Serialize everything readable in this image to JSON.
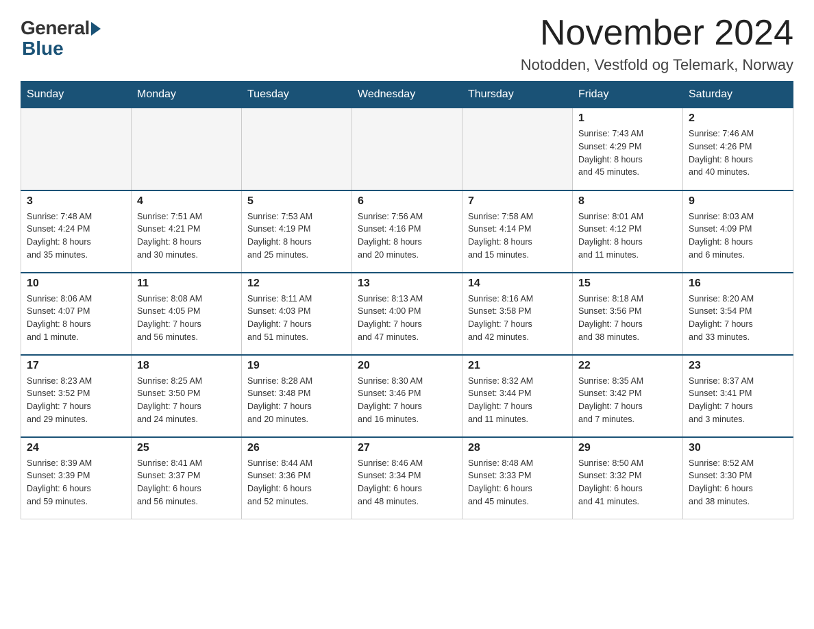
{
  "logo": {
    "general": "General",
    "blue": "Blue"
  },
  "title": "November 2024",
  "location": "Notodden, Vestfold og Telemark, Norway",
  "days_of_week": [
    "Sunday",
    "Monday",
    "Tuesday",
    "Wednesday",
    "Thursday",
    "Friday",
    "Saturday"
  ],
  "weeks": [
    [
      {
        "day": "",
        "info": ""
      },
      {
        "day": "",
        "info": ""
      },
      {
        "day": "",
        "info": ""
      },
      {
        "day": "",
        "info": ""
      },
      {
        "day": "",
        "info": ""
      },
      {
        "day": "1",
        "info": "Sunrise: 7:43 AM\nSunset: 4:29 PM\nDaylight: 8 hours\nand 45 minutes."
      },
      {
        "day": "2",
        "info": "Sunrise: 7:46 AM\nSunset: 4:26 PM\nDaylight: 8 hours\nand 40 minutes."
      }
    ],
    [
      {
        "day": "3",
        "info": "Sunrise: 7:48 AM\nSunset: 4:24 PM\nDaylight: 8 hours\nand 35 minutes."
      },
      {
        "day": "4",
        "info": "Sunrise: 7:51 AM\nSunset: 4:21 PM\nDaylight: 8 hours\nand 30 minutes."
      },
      {
        "day": "5",
        "info": "Sunrise: 7:53 AM\nSunset: 4:19 PM\nDaylight: 8 hours\nand 25 minutes."
      },
      {
        "day": "6",
        "info": "Sunrise: 7:56 AM\nSunset: 4:16 PM\nDaylight: 8 hours\nand 20 minutes."
      },
      {
        "day": "7",
        "info": "Sunrise: 7:58 AM\nSunset: 4:14 PM\nDaylight: 8 hours\nand 15 minutes."
      },
      {
        "day": "8",
        "info": "Sunrise: 8:01 AM\nSunset: 4:12 PM\nDaylight: 8 hours\nand 11 minutes."
      },
      {
        "day": "9",
        "info": "Sunrise: 8:03 AM\nSunset: 4:09 PM\nDaylight: 8 hours\nand 6 minutes."
      }
    ],
    [
      {
        "day": "10",
        "info": "Sunrise: 8:06 AM\nSunset: 4:07 PM\nDaylight: 8 hours\nand 1 minute."
      },
      {
        "day": "11",
        "info": "Sunrise: 8:08 AM\nSunset: 4:05 PM\nDaylight: 7 hours\nand 56 minutes."
      },
      {
        "day": "12",
        "info": "Sunrise: 8:11 AM\nSunset: 4:03 PM\nDaylight: 7 hours\nand 51 minutes."
      },
      {
        "day": "13",
        "info": "Sunrise: 8:13 AM\nSunset: 4:00 PM\nDaylight: 7 hours\nand 47 minutes."
      },
      {
        "day": "14",
        "info": "Sunrise: 8:16 AM\nSunset: 3:58 PM\nDaylight: 7 hours\nand 42 minutes."
      },
      {
        "day": "15",
        "info": "Sunrise: 8:18 AM\nSunset: 3:56 PM\nDaylight: 7 hours\nand 38 minutes."
      },
      {
        "day": "16",
        "info": "Sunrise: 8:20 AM\nSunset: 3:54 PM\nDaylight: 7 hours\nand 33 minutes."
      }
    ],
    [
      {
        "day": "17",
        "info": "Sunrise: 8:23 AM\nSunset: 3:52 PM\nDaylight: 7 hours\nand 29 minutes."
      },
      {
        "day": "18",
        "info": "Sunrise: 8:25 AM\nSunset: 3:50 PM\nDaylight: 7 hours\nand 24 minutes."
      },
      {
        "day": "19",
        "info": "Sunrise: 8:28 AM\nSunset: 3:48 PM\nDaylight: 7 hours\nand 20 minutes."
      },
      {
        "day": "20",
        "info": "Sunrise: 8:30 AM\nSunset: 3:46 PM\nDaylight: 7 hours\nand 16 minutes."
      },
      {
        "day": "21",
        "info": "Sunrise: 8:32 AM\nSunset: 3:44 PM\nDaylight: 7 hours\nand 11 minutes."
      },
      {
        "day": "22",
        "info": "Sunrise: 8:35 AM\nSunset: 3:42 PM\nDaylight: 7 hours\nand 7 minutes."
      },
      {
        "day": "23",
        "info": "Sunrise: 8:37 AM\nSunset: 3:41 PM\nDaylight: 7 hours\nand 3 minutes."
      }
    ],
    [
      {
        "day": "24",
        "info": "Sunrise: 8:39 AM\nSunset: 3:39 PM\nDaylight: 6 hours\nand 59 minutes."
      },
      {
        "day": "25",
        "info": "Sunrise: 8:41 AM\nSunset: 3:37 PM\nDaylight: 6 hours\nand 56 minutes."
      },
      {
        "day": "26",
        "info": "Sunrise: 8:44 AM\nSunset: 3:36 PM\nDaylight: 6 hours\nand 52 minutes."
      },
      {
        "day": "27",
        "info": "Sunrise: 8:46 AM\nSunset: 3:34 PM\nDaylight: 6 hours\nand 48 minutes."
      },
      {
        "day": "28",
        "info": "Sunrise: 8:48 AM\nSunset: 3:33 PM\nDaylight: 6 hours\nand 45 minutes."
      },
      {
        "day": "29",
        "info": "Sunrise: 8:50 AM\nSunset: 3:32 PM\nDaylight: 6 hours\nand 41 minutes."
      },
      {
        "day": "30",
        "info": "Sunrise: 8:52 AM\nSunset: 3:30 PM\nDaylight: 6 hours\nand 38 minutes."
      }
    ]
  ]
}
